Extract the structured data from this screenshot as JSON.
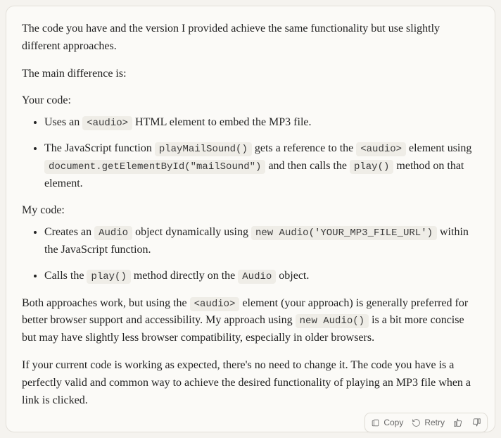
{
  "message": {
    "p1": "The code you have and the version I provided achieve the same functionality but use slightly different approaches.",
    "p2": "The main difference is:",
    "your_code_label": "Your code:",
    "your_code_items": [
      {
        "pre": "Uses an ",
        "c1": "<audio>",
        "post": " HTML element to embed the MP3 file."
      },
      {
        "pre": "The JavaScript function ",
        "c1": "playMailSound()",
        "mid1": " gets a reference to the ",
        "c2": "<audio>",
        "mid2": " element using ",
        "c3": "document.getElementById(\"mailSound\")",
        "mid3": " and then calls the ",
        "c4": "play()",
        "post": " method on that element."
      }
    ],
    "my_code_label": "My code:",
    "my_code_items": [
      {
        "pre": "Creates an ",
        "c1": "Audio",
        "mid1": " object dynamically using ",
        "c2": "new Audio('YOUR_MP3_FILE_URL')",
        "post": " within the JavaScript function."
      },
      {
        "pre": "Calls the ",
        "c1": "play()",
        "mid1": " method directly on the ",
        "c2": "Audio",
        "post": " object."
      }
    ],
    "p3_pre": "Both approaches work, but using the ",
    "p3_c1": "<audio>",
    "p3_mid1": " element (your approach) is generally preferred for better browser support and accessibility. My approach using ",
    "p3_c2": "new Audio()",
    "p3_post": " is a bit more concise but may have slightly less browser compatibility, especially in older browsers.",
    "p4": "If your current code is working as expected, there's no need to change it. The code you have is a perfectly valid and common way to achieve the desired functionality of playing an MP3 file when a link is clicked."
  },
  "actions": {
    "copy": "Copy",
    "retry": "Retry"
  }
}
